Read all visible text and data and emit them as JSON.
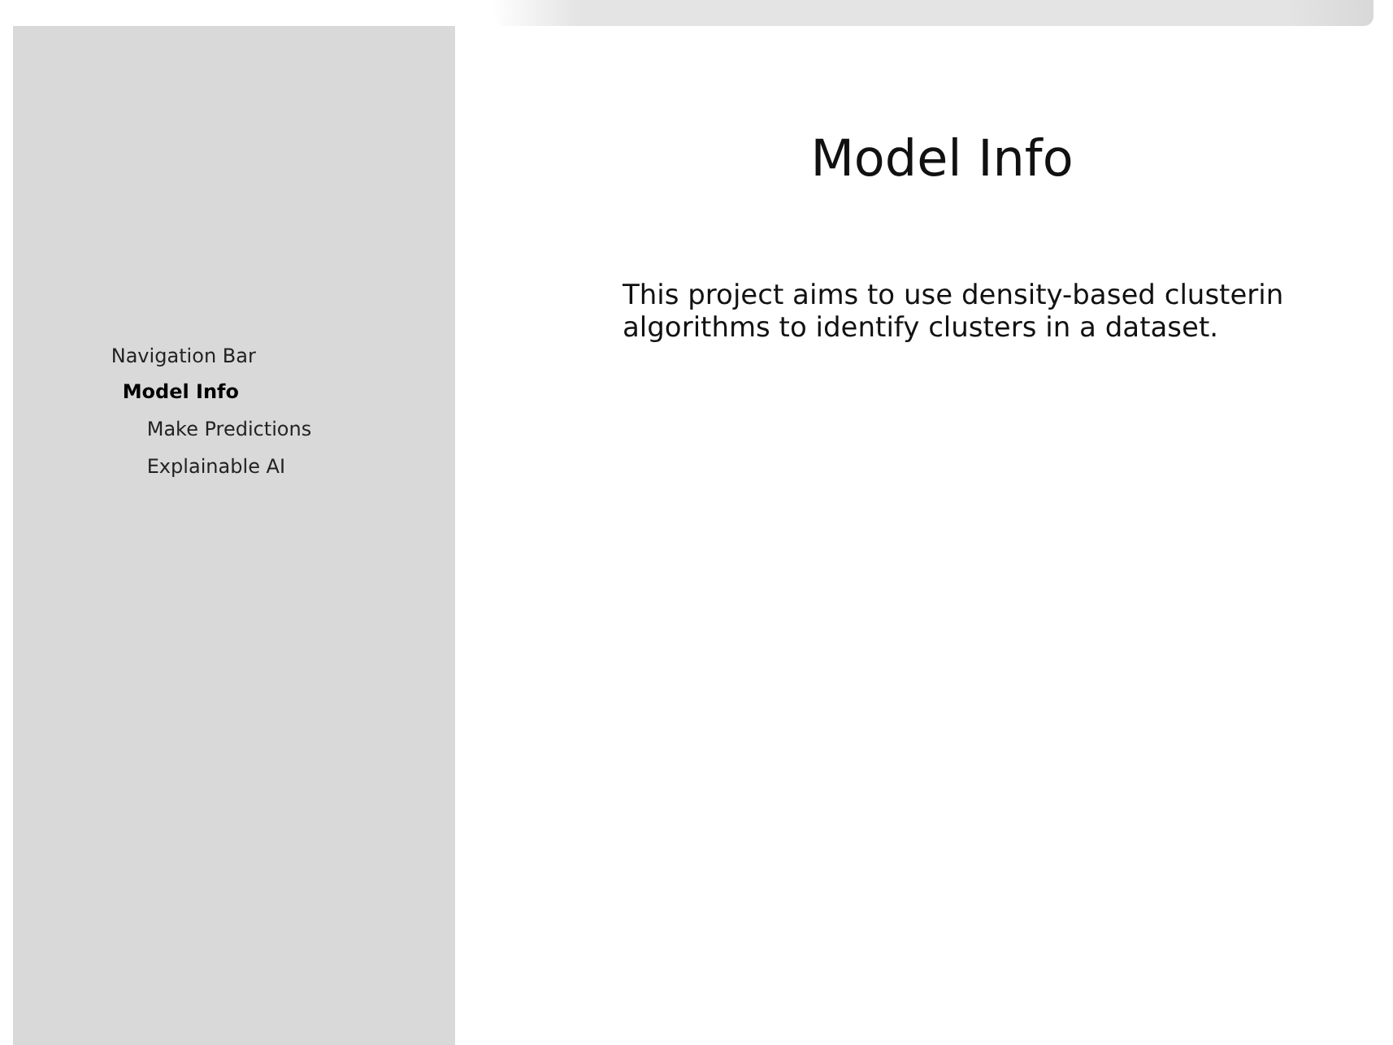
{
  "sidebar": {
    "heading": "Navigation Bar",
    "items": [
      {
        "label": "Model Info",
        "selected": true
      },
      {
        "label": "Make Predictions",
        "selected": false
      },
      {
        "label": "Explainable AI",
        "selected": false
      }
    ]
  },
  "main": {
    "title": "Model Info",
    "description": "This project aims to use density-based clusterin\nalgorithms to identify clusters in a dataset."
  }
}
